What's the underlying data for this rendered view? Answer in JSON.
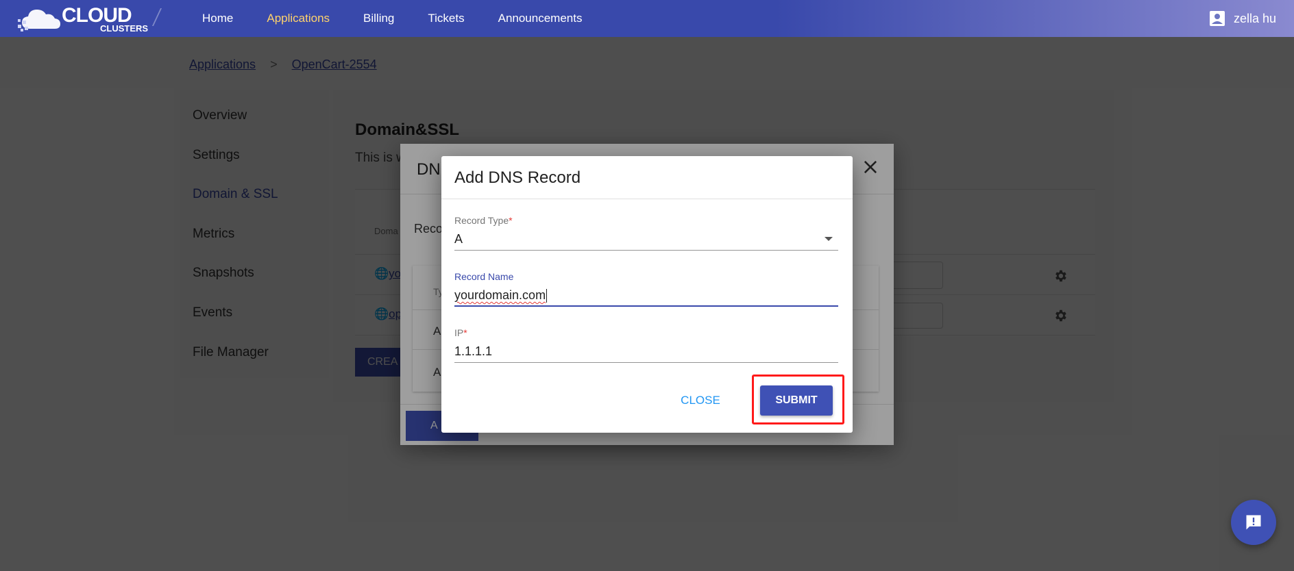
{
  "brand": {
    "name": "CLOUD",
    "sub": "CLUSTERS"
  },
  "nav": {
    "items": [
      "Home",
      "Applications",
      "Billing",
      "Tickets",
      "Announcements"
    ],
    "active": "Applications"
  },
  "user": {
    "name": "zella hu"
  },
  "breadcrumb": {
    "items": [
      "Applications",
      "OpenCart-2554"
    ],
    "separator": ">"
  },
  "sidebar": {
    "items": [
      "Overview",
      "Settings",
      "Domain & SSL",
      "Metrics",
      "Snapshots",
      "Events",
      "File Manager"
    ],
    "active": "Domain & SSL"
  },
  "content": {
    "title": "Domain&SSL",
    "description": "This is w",
    "table_header_domain": "Doma",
    "row1_text": "yo",
    "row2_text": "op",
    "create_button": "CREA"
  },
  "background_dialog": {
    "title": "DN",
    "label": "Reco",
    "table_header": "Ty",
    "rows": [
      "A",
      "A"
    ],
    "add_button": "A"
  },
  "dialog": {
    "title": "Add DNS Record",
    "record_type": {
      "label": "Record Type",
      "value": "A",
      "required": "*"
    },
    "record_name": {
      "label": "Record Name",
      "value": "yourdomain.com"
    },
    "ip": {
      "label": "IP",
      "value": "1.1.1.1",
      "required": "*"
    },
    "close_button": "CLOSE",
    "submit_button": "SUBMIT"
  },
  "colors": {
    "primary": "#3f51b5",
    "active_nav": "#ffd36b",
    "highlight": "#ff1a1a",
    "link": "#2196f3"
  }
}
